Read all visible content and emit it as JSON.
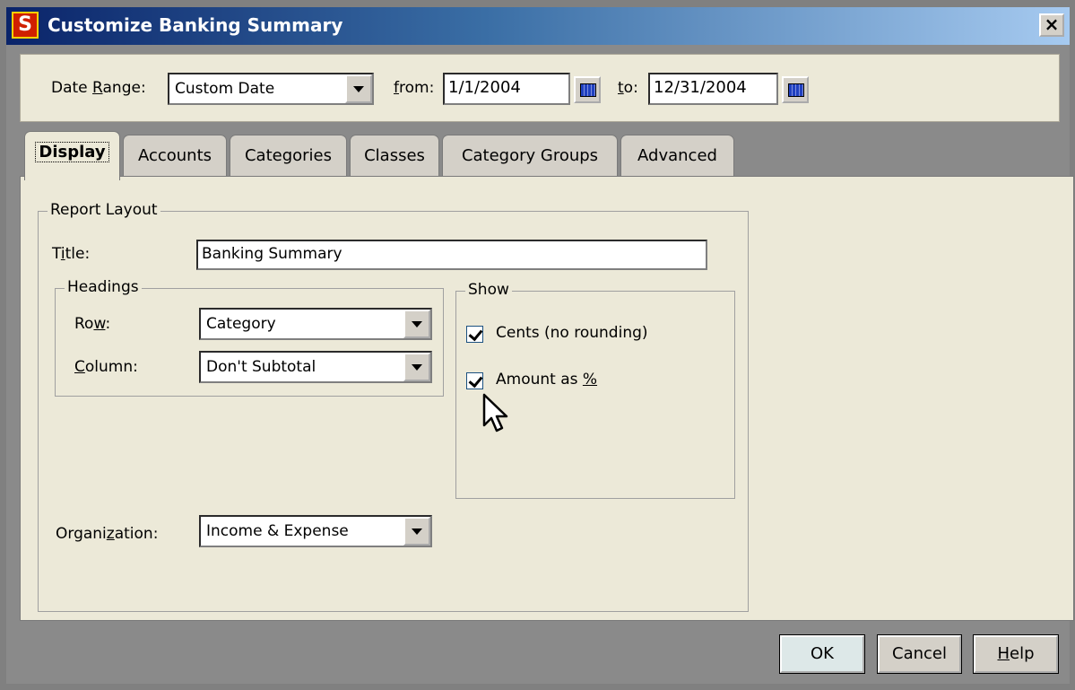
{
  "window": {
    "title": "Customize Banking Summary",
    "close_label": "×"
  },
  "date_bar": {
    "date_range_label": "Date Range:",
    "date_range_value": "Custom Date",
    "from_label": "from:",
    "from_value": "1/1/2004",
    "to_label": "to:",
    "to_value": "12/31/2004"
  },
  "tabs": [
    {
      "label": "Display",
      "active": true
    },
    {
      "label": "Accounts"
    },
    {
      "label": "Categories"
    },
    {
      "label": "Classes"
    },
    {
      "label": "Category Groups"
    },
    {
      "label": "Advanced"
    }
  ],
  "report_layout": {
    "group_title": "Report Layout",
    "title_label": "Title:",
    "title_value": "Banking Summary",
    "headings": {
      "group_title": "Headings",
      "row_label": "Row:",
      "row_value": "Category",
      "column_label": "Column:",
      "column_value": "Don't Subtotal"
    },
    "show": {
      "group_title": "Show",
      "cents_label": "Cents (no rounding)",
      "cents_checked": true,
      "amount_pct_label": "Amount as %",
      "amount_pct_checked": true
    },
    "organization_label": "Organization:",
    "organization_value": "Income & Expense"
  },
  "buttons": {
    "ok": "OK",
    "cancel": "Cancel",
    "help": "Help"
  }
}
